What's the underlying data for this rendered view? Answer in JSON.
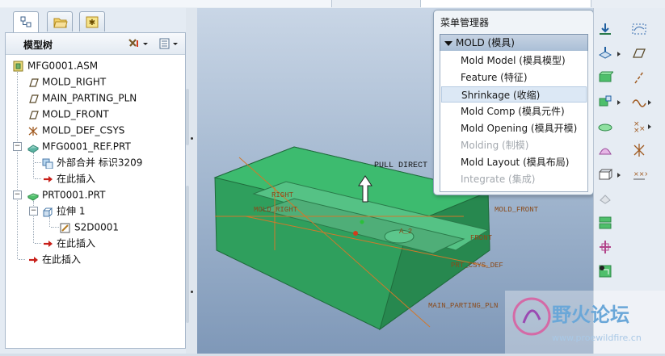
{
  "nav_tabs": [
    {
      "name": "model-tree-tab",
      "icon": "model-tree-icon"
    },
    {
      "name": "folder-browser-tab",
      "icon": "folder-icon"
    },
    {
      "name": "favorites-tab",
      "icon": "star-icon"
    }
  ],
  "model_tree": {
    "title": "模型树",
    "items": [
      {
        "label": "MFG0001.ASM",
        "icon": "assembly-icon"
      },
      {
        "label": "MOLD_RIGHT",
        "icon": "datum-plane-icon"
      },
      {
        "label": "MAIN_PARTING_PLN",
        "icon": "datum-plane-icon"
      },
      {
        "label": "MOLD_FRONT",
        "icon": "datum-plane-icon"
      },
      {
        "label": "MOLD_DEF_CSYS",
        "icon": "csys-icon"
      },
      {
        "label": "MFG0001_REF.PRT",
        "icon": "reference-part-icon"
      },
      {
        "label": "外部合并 标识3209",
        "icon": "merge-icon"
      },
      {
        "label": "在此插入",
        "icon": "insert-arrow-icon"
      },
      {
        "label": "PRT0001.PRT",
        "icon": "part-icon"
      },
      {
        "label": "拉伸 1",
        "icon": "extrude-icon"
      },
      {
        "label": "S2D0001",
        "icon": "sketch-icon"
      },
      {
        "label": "在此插入",
        "icon": "insert-arrow-icon"
      },
      {
        "label": "在此插入",
        "icon": "insert-arrow-icon"
      }
    ]
  },
  "viewport": {
    "labels": {
      "pull_direction": "PULL DIRECT",
      "right": "RIGHT",
      "mold_right": "MOLD_RIGHT",
      "mold_front": "MOLD_FRONT",
      "front": "FRONT",
      "a2": "A_2",
      "prt_csys_def": "PRT_CSYS_DEF",
      "main_parting": "MAIN_PARTING_PLN"
    }
  },
  "menu_manager": {
    "title": "菜单管理器",
    "header": "MOLD (模具)",
    "items": [
      {
        "label": "Mold Model (模具模型)",
        "state": "normal"
      },
      {
        "label": "Feature (特征)",
        "state": "normal"
      },
      {
        "label": "Shrinkage (收缩)",
        "state": "highlighted"
      },
      {
        "label": "Mold Comp (模具元件)",
        "state": "normal"
      },
      {
        "label": "Mold Opening (模具开模)",
        "state": "normal"
      },
      {
        "label": "Molding (制模)",
        "state": "disabled"
      },
      {
        "label": "Mold Layout (模具布局)",
        "state": "normal"
      },
      {
        "label": "Integrate (集成)",
        "state": "disabled"
      }
    ]
  },
  "right_toolbar": [
    "point-tool-icon",
    "sketch-curve-icon",
    "plane-tool-icon",
    "datum-plane-icon",
    "block-tool-icon",
    "axis-tool-icon",
    "pipe-tool-icon",
    "curve-tool-icon",
    "shell-tool-icon",
    "point-array-icon",
    "surface-tool-icon",
    "csys-tool-icon",
    "box-tool-icon",
    "analysis-icon",
    "shrink-tool-icon",
    "split-tool-icon",
    "mold-open-icon",
    "layout-tool-icon"
  ],
  "watermark": {
    "text": "野火论坛",
    "url": "www.proewildfire.cn"
  },
  "colors": {
    "model_green": "#3aa363",
    "model_dark": "#267d46",
    "datum_orange": "#d2782a",
    "label_brown": "#8a4a1a"
  }
}
